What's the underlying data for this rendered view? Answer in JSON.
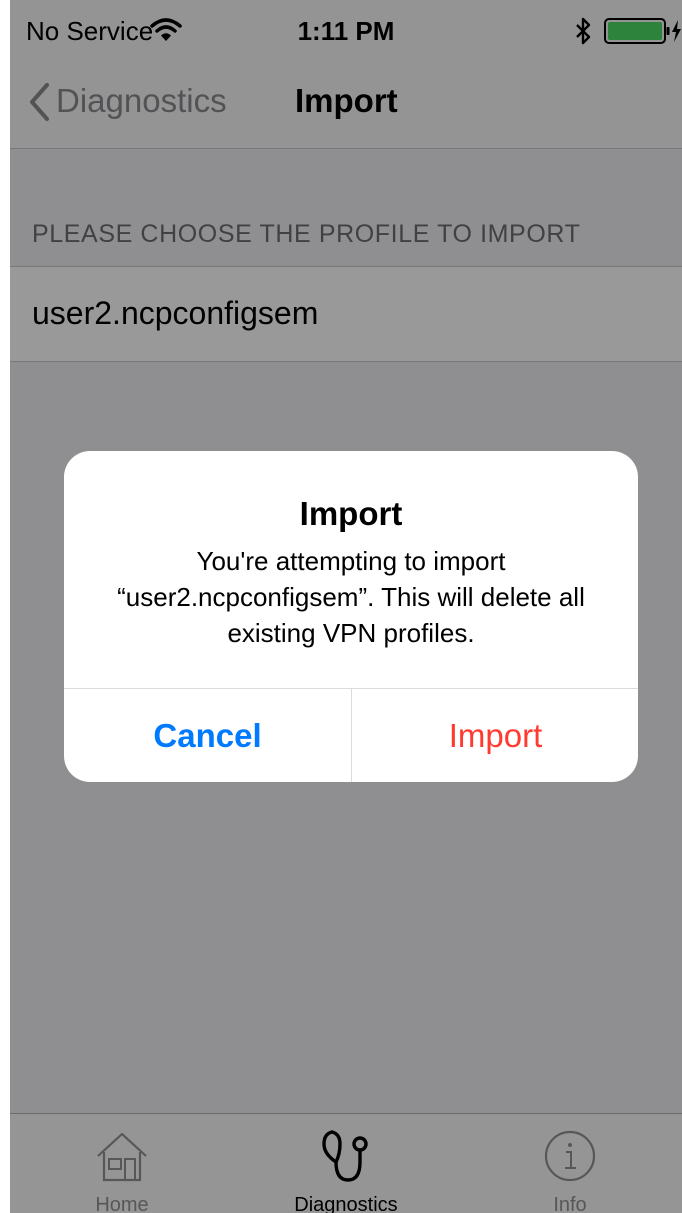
{
  "status_bar": {
    "carrier": "No Service",
    "time": "1:11 PM",
    "battery_color": "#4cd964"
  },
  "nav_bar": {
    "back_label": "Diagnostics",
    "title": "Import"
  },
  "content": {
    "section_header": "PLEASE CHOOSE THE PROFILE TO IMPORT",
    "profile_name": "user2.ncpconfigsem"
  },
  "alert": {
    "title": "Import",
    "message": "You're attempting to import “user2.ncpconfigsem”. This will delete all existing VPN profiles.",
    "cancel_label": "Cancel",
    "import_label": "Import",
    "cancel_color": "#007aff",
    "import_color": "#ff3b30"
  },
  "tab_bar": {
    "tabs": [
      {
        "label": "Home",
        "icon": "home-icon",
        "selected": false
      },
      {
        "label": "Diagnostics",
        "icon": "stethoscope-icon",
        "selected": true
      },
      {
        "label": "Info",
        "icon": "info-icon",
        "selected": false
      }
    ],
    "active_color": "#000000",
    "inactive_color": "#929292"
  }
}
